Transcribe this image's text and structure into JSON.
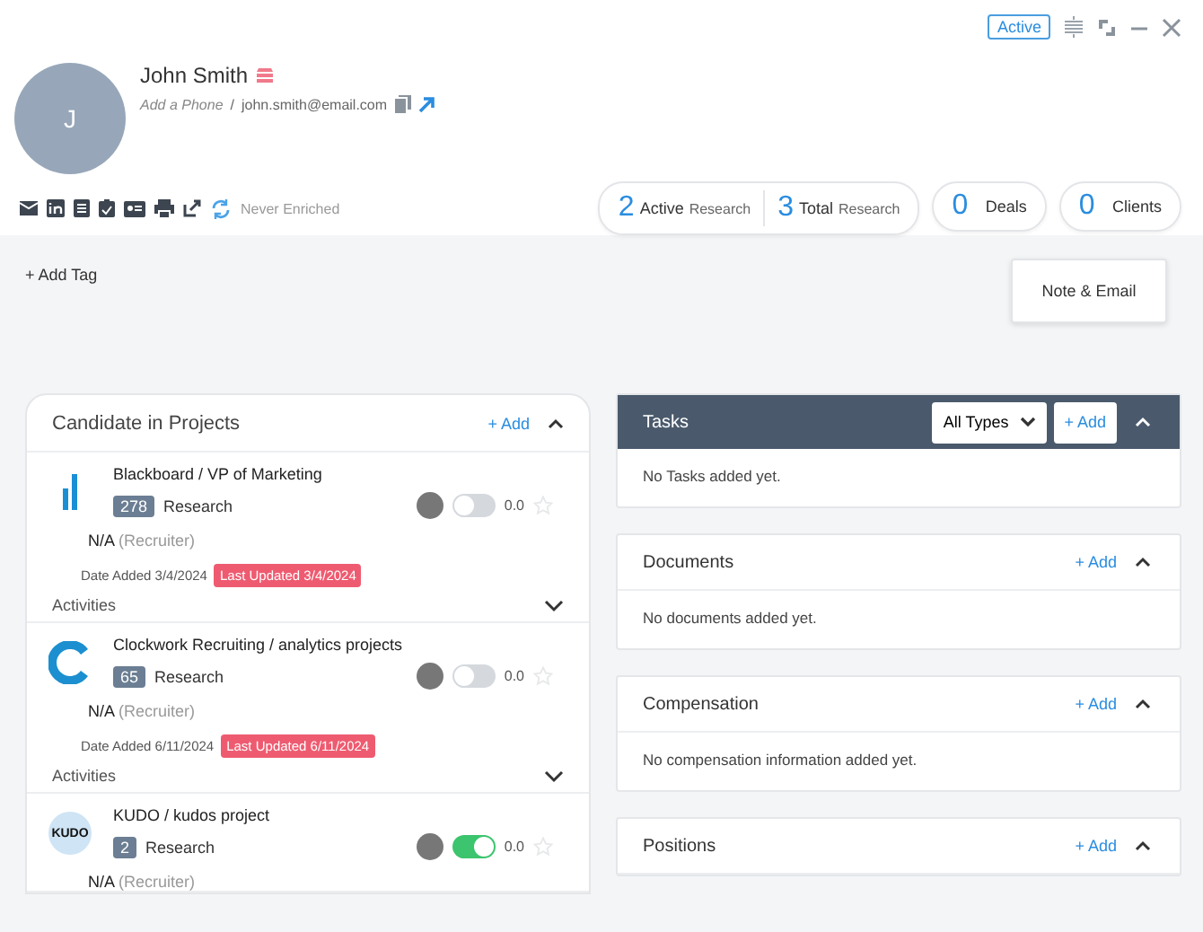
{
  "header": {
    "status_badge": "Active",
    "avatar_initial": "J",
    "name": "John Smith",
    "phone_placeholder": "Add a Phone",
    "separator": "/",
    "email": "john.smith@email.com",
    "enrichment": "Never Enriched"
  },
  "stats": [
    {
      "kind": "double",
      "items": [
        {
          "count": "2",
          "label": "Active",
          "sub": "Research"
        },
        {
          "count": "3",
          "label": "Total",
          "sub": "Research"
        }
      ]
    },
    {
      "kind": "single",
      "items": [
        {
          "count": "0",
          "label": "Deals"
        }
      ]
    },
    {
      "kind": "single",
      "items": [
        {
          "count": "0",
          "label": "Clients"
        }
      ]
    }
  ],
  "add_tag": "+ Add Tag",
  "note_button": "Note & Email",
  "projects": {
    "title": "Candidate in Projects",
    "add": "+ Add",
    "expanded": true,
    "items": [
      {
        "kind": "bars",
        "name": "Blackboard / VP of Marketing",
        "count": "278",
        "stage": "Research",
        "on": false,
        "rating": "0.0",
        "starred": false,
        "owner": "N/A",
        "role": "(Recruiter)",
        "date_added": "Date Added 3/4/2024",
        "last_updated": "Last Updated 3/4/2024",
        "activities": "Activities"
      },
      {
        "kind": "c",
        "name": "Clockwork Recruiting / analytics projects",
        "count": "65",
        "stage": "Research",
        "on": false,
        "rating": "0.0",
        "starred": false,
        "owner": "N/A",
        "role": "(Recruiter)",
        "date_added": "Date Added 6/11/2024",
        "last_updated": "Last Updated 6/11/2024",
        "activities": "Activities"
      },
      {
        "kind": "kudo",
        "logo_text": "KUDO",
        "name": "KUDO / kudos project",
        "count": "2",
        "stage": "Research",
        "on": true,
        "rating": "0.0",
        "starred": false,
        "owner": "N/A",
        "role": "(Recruiter)"
      }
    ]
  },
  "panels": [
    {
      "kind": "tasks",
      "title": "Tasks",
      "filter": "All Types",
      "add": "+ Add",
      "expanded": true,
      "empty": "No Tasks added yet."
    },
    {
      "kind": "plain",
      "title": "Documents",
      "add": "+ Add",
      "expanded": true,
      "empty": "No documents added yet."
    },
    {
      "kind": "plain",
      "title": "Compensation",
      "add": "+ Add",
      "expanded": true,
      "empty": "No compensation information added yet."
    },
    {
      "kind": "plain",
      "title": "Positions",
      "add": "+ Add",
      "expanded": true
    }
  ]
}
